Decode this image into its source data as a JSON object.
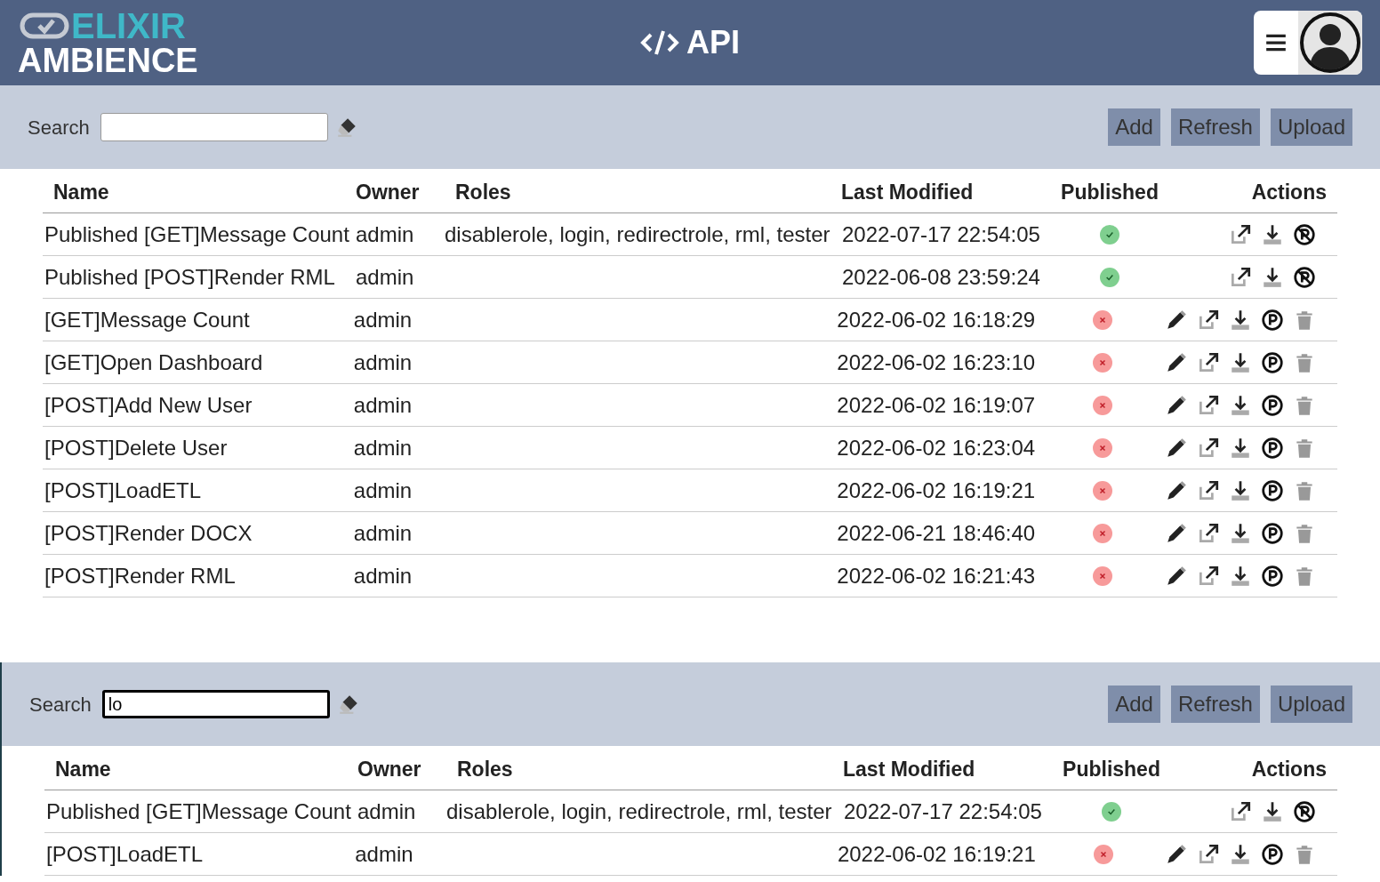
{
  "header": {
    "logo_top": "ELIXIR",
    "logo_bottom": "AMBIENCE",
    "title": "API"
  },
  "panels": [
    {
      "search": {
        "label": "Search",
        "focused": false
      },
      "buttons": [
        "Add",
        "Refresh",
        "Upload"
      ],
      "columns": [
        "Name",
        "Owner",
        "Roles",
        "Last Modified",
        "Published",
        "Actions"
      ],
      "rows": [
        {
          "name": "Published [GET]Message Count",
          "owner": "admin",
          "roles": "disablerole, login, redirectrole, rml, tester",
          "modified": "2022-07-17 22:54:05",
          "published": true
        },
        {
          "name": "Published [POST]Render RML",
          "owner": "admin",
          "roles": "",
          "modified": "2022-06-08 23:59:24",
          "published": true
        },
        {
          "name": "[GET]Message Count",
          "owner": "admin",
          "roles": "",
          "modified": "2022-06-02 16:18:29",
          "published": false
        },
        {
          "name": "[GET]Open Dashboard",
          "owner": "admin",
          "roles": "",
          "modified": "2022-06-02 16:23:10",
          "published": false
        },
        {
          "name": "[POST]Add New User",
          "owner": "admin",
          "roles": "",
          "modified": "2022-06-02 16:19:07",
          "published": false
        },
        {
          "name": "[POST]Delete User",
          "owner": "admin",
          "roles": "",
          "modified": "2022-06-02 16:23:04",
          "published": false
        },
        {
          "name": "[POST]LoadETL",
          "owner": "admin",
          "roles": "",
          "modified": "2022-06-02 16:19:21",
          "published": false
        },
        {
          "name": "[POST]Render DOCX",
          "owner": "admin",
          "roles": "",
          "modified": "2022-06-21 18:46:40",
          "published": false
        },
        {
          "name": "[POST]Render RML",
          "owner": "admin",
          "roles": "",
          "modified": "2022-06-02 16:21:43",
          "published": false
        }
      ]
    },
    {
      "search": {
        "label": "Search",
        "value": "lo",
        "focused": true
      },
      "buttons": [
        "Add",
        "Refresh",
        "Upload"
      ],
      "columns": [
        "Name",
        "Owner",
        "Roles",
        "Last Modified",
        "Published",
        "Actions"
      ],
      "rows": [
        {
          "name": "Published [GET]Message Count",
          "owner": "admin",
          "roles": "disablerole, login, redirectrole, rml, tester",
          "modified": "2022-07-17 22:54:05",
          "published": true
        },
        {
          "name": "[POST]LoadETL",
          "owner": "admin",
          "roles": "",
          "modified": "2022-06-02 16:19:21",
          "published": false
        }
      ]
    }
  ]
}
